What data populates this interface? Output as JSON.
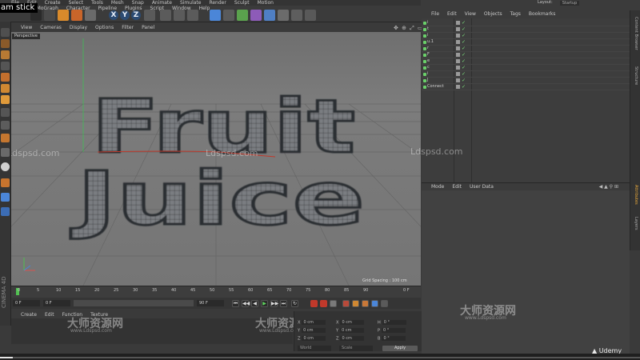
{
  "video": {
    "title": "am stick",
    "progress_percent": 2
  },
  "app": {
    "menu": [
      "File",
      "Edit",
      "Create",
      "Select",
      "Tools",
      "Mesh",
      "Snap",
      "Animate",
      "Simulate",
      "Render",
      "Sculpt",
      "Motion Tracker",
      "MoGraph",
      "Character",
      "Pipeline",
      "Plugins",
      "Script",
      "Window",
      "Help"
    ],
    "layout_label": "Layout:",
    "layout_value": "Startup",
    "brand": "CINEMA 4D"
  },
  "viewport": {
    "menu": [
      "View",
      "Cameras",
      "Display",
      "Options",
      "Filter",
      "Panel"
    ],
    "label": "Perspective",
    "grid_spacing": "Grid Spacing : 100 cm",
    "icons": "✥ ⊕ ⤢ ▭"
  },
  "model": {
    "line1": "Fruit",
    "line2": "Juice"
  },
  "watermarks": [
    "Ldspsd.com",
    "Ldspsd.com",
    "Ldspsd.com",
    "大师资源网",
    "www.Ldspsd.com",
    "大师资源网",
    "www.Ldspsd.com",
    "大师资源网",
    "www.Ldspsd.com"
  ],
  "timeline": {
    "ticks": [
      "0",
      "5",
      "10",
      "15",
      "20",
      "25",
      "30",
      "35",
      "40",
      "45",
      "50",
      "55",
      "60",
      "65",
      "70",
      "75",
      "80",
      "85",
      "90"
    ],
    "end_tick": "0 F",
    "start_frame": "0 F",
    "min_frame": "0 F",
    "max_frame": "90 F",
    "end_frame": "90 F"
  },
  "playback": [
    "⏮",
    "◀◀",
    "◀",
    "▶",
    "▶▶",
    "⏭",
    "↻"
  ],
  "material": {
    "menu": [
      "Create",
      "Edit",
      "Function",
      "Texture"
    ]
  },
  "coords": {
    "rows": [
      {
        "a": "X",
        "av": "0 cm",
        "b": "X",
        "bv": "0 cm",
        "c": "H",
        "cv": "0 °"
      },
      {
        "a": "Y",
        "av": "0 cm",
        "b": "Y",
        "bv": "0 cm",
        "c": "P",
        "cv": "0 °"
      },
      {
        "a": "Z",
        "av": "0 cm",
        "b": "Z",
        "bv": "0 cm",
        "c": "B",
        "cv": "0 °"
      }
    ],
    "mode1": "World",
    "mode2": "Scale",
    "apply": "Apply"
  },
  "objects": {
    "menu": [
      "File",
      "Edit",
      "View",
      "Objects",
      "Tags",
      "Bookmarks"
    ],
    "rows": [
      "i",
      "t",
      "i",
      "u.1",
      "r",
      "F",
      "e",
      "c",
      "i",
      "J",
      "Connect"
    ]
  },
  "attributes": {
    "menu": [
      "Mode",
      "Edit",
      "User Data"
    ]
  },
  "right_tabs": [
    "Content Browser",
    "Structure",
    "Attributes",
    "Layers"
  ],
  "udemy": "Udemy",
  "colors": {
    "accent": "#4b86d8",
    "mesh": "#6f7276",
    "check": "#7ee07e"
  }
}
